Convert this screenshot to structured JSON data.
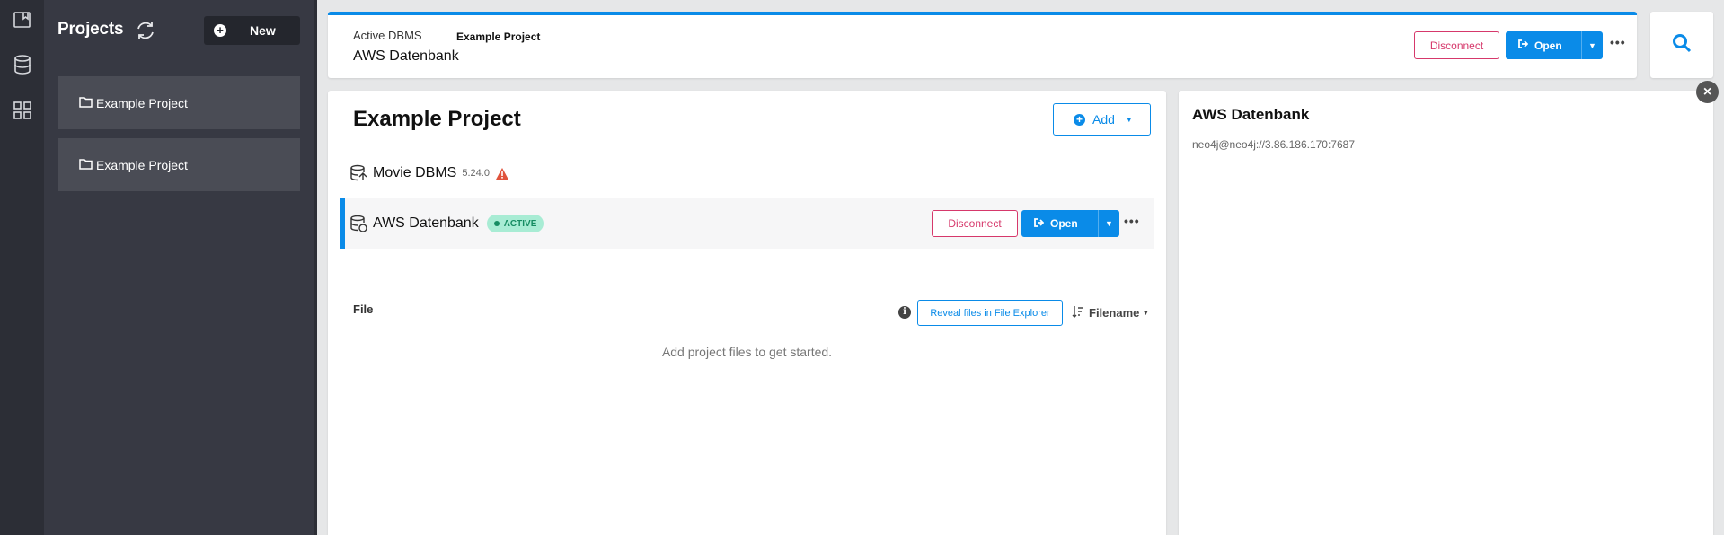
{
  "sidebar_rail": {
    "items": [
      {
        "icon": "projects-icon"
      },
      {
        "icon": "database-icon"
      },
      {
        "icon": "graph-apps-icon"
      }
    ]
  },
  "projects_panel": {
    "title": "Projects",
    "refresh_icon": "refresh-icon",
    "new_label": "New",
    "items": [
      {
        "label": "Example Project"
      },
      {
        "label": "Example Project"
      }
    ]
  },
  "header": {
    "active_label": "Active DBMS",
    "project_name": "Example Project",
    "db_name": "AWS Datenbank",
    "disconnect_label": "Disconnect",
    "open_label": "Open"
  },
  "main": {
    "title": "Example Project",
    "add_label": "Add",
    "dbms": [
      {
        "name": "Movie DBMS",
        "version": "5.24.0",
        "warning": true
      },
      {
        "name": "AWS Datenbank",
        "badge": "ACTIVE",
        "disconnect_label": "Disconnect",
        "open_label": "Open"
      }
    ],
    "files": {
      "label": "File",
      "reveal_label": "Reveal files in File Explorer",
      "sort_label": "Filename",
      "empty_message": "Add project files to get started."
    }
  },
  "detail": {
    "title": "AWS Datenbank",
    "uri": "neo4j@neo4j://3.86.186.170:7687"
  },
  "colors": {
    "accent": "#0a8be8",
    "danger": "#d6386b",
    "active_badge_bg": "#a8ecd4",
    "active_badge_text": "#168c62",
    "warning": "#e0533c"
  }
}
